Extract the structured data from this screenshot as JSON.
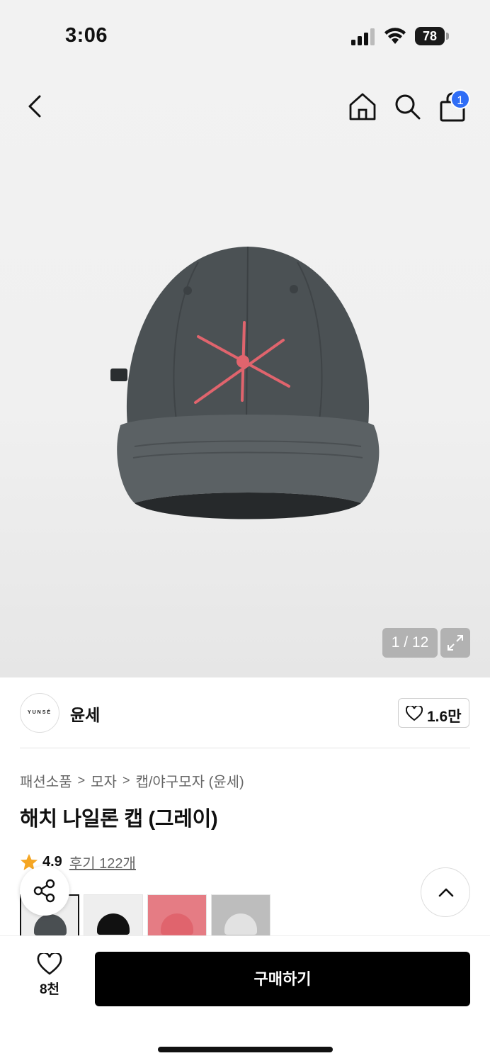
{
  "status_bar": {
    "time": "3:06",
    "battery": "78"
  },
  "header": {
    "cart_count": "1"
  },
  "gallery": {
    "counter": "1 / 12"
  },
  "brand": {
    "logo_text": "YUNSÉ",
    "name": "윤세",
    "likes": "1.6만"
  },
  "breadcrumb": [
    "패션소품",
    "모자",
    "캡/야구모자 (윤세)"
  ],
  "breadcrumb_sep": ">",
  "product": {
    "title": "해치 나일론 캡 (그레이)",
    "rating": "4.9",
    "reviews": "후기 122개"
  },
  "thumbnails": [
    {
      "color": "#4a4f52"
    },
    {
      "color": "#111111"
    },
    {
      "color": "#e0646d"
    },
    {
      "color": "#d6d6d6"
    }
  ],
  "bottom": {
    "wish_count": "8천",
    "buy_label": "구매하기"
  },
  "colors": {
    "accent_badge": "#2f6df6",
    "star": "#f5a623",
    "cap_body": "#4b5154",
    "logo_red": "#e0646d"
  }
}
